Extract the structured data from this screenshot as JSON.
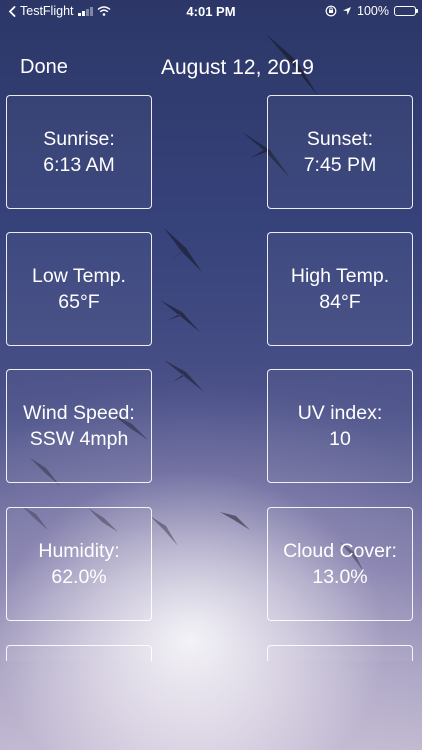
{
  "status_bar": {
    "back_app": "TestFlight",
    "time": "4:01 PM",
    "battery": "100%"
  },
  "nav": {
    "done_label": "Done",
    "title": "August 12, 2019"
  },
  "tiles": [
    {
      "label": "Sunrise:",
      "value": "6:13 AM"
    },
    {
      "label": "Sunset:",
      "value": "7:45 PM"
    },
    {
      "label": "Low Temp.",
      "value": "65°F"
    },
    {
      "label": "High Temp.",
      "value": "84°F"
    },
    {
      "label": "Wind Speed:",
      "value": "SSW 4mph"
    },
    {
      "label": "UV index:",
      "value": "10"
    },
    {
      "label": "Humidity:",
      "value": "62.0%"
    },
    {
      "label": "Cloud Cover:",
      "value": "13.0%"
    }
  ],
  "icons": {
    "back": "back-arrow-icon",
    "signal": "cellular-signal-icon",
    "wifi": "wifi-icon",
    "lock_rotation": "orientation-lock-icon",
    "location": "location-arrow-icon",
    "battery": "battery-icon"
  }
}
